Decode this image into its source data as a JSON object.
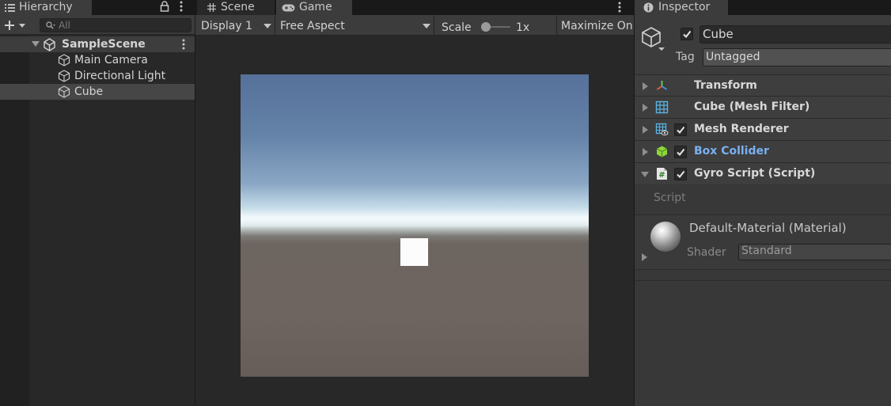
{
  "hierarchy": {
    "tab_label": "Hierarchy",
    "search_placeholder": "All",
    "scene_name": "SampleScene",
    "items": [
      {
        "label": "Main Camera",
        "selected": false
      },
      {
        "label": "Directional Light",
        "selected": false
      },
      {
        "label": "Cube",
        "selected": true
      }
    ]
  },
  "game": {
    "tabs": [
      {
        "label": "Scene",
        "icon": "grid-icon",
        "active": false
      },
      {
        "label": "Game",
        "icon": "gamepad-icon",
        "active": true
      }
    ],
    "display": "Display 1",
    "aspect": "Free Aspect",
    "scale_label": "Scale",
    "scale_value": "1x",
    "maximize_label": "Maximize On Play",
    "sky_color": "#56709a",
    "ground_color": "#6e6460",
    "cube_color": "#fcfcfc"
  },
  "inspector": {
    "tab_label": "Inspector",
    "object_name": "Cube",
    "object_active": true,
    "tag_label": "Tag",
    "tag_value": "Untagged",
    "components": [
      {
        "title": "Transform",
        "icon": "transform-axes-icon",
        "has_checkbox": false,
        "expanded": false
      },
      {
        "title": "Cube (Mesh Filter)",
        "icon": "mesh-filter-icon",
        "has_checkbox": false,
        "expanded": false
      },
      {
        "title": "Mesh Renderer",
        "icon": "mesh-renderer-icon",
        "has_checkbox": true,
        "enabled": true,
        "expanded": false
      },
      {
        "title": "Box Collider",
        "icon": "box-collider-icon",
        "has_checkbox": true,
        "enabled": true,
        "expanded": false,
        "title_color": "#7ab0f0"
      },
      {
        "title": "Gyro Script (Script)",
        "icon": "script-icon",
        "has_checkbox": true,
        "enabled": true,
        "expanded": true
      }
    ],
    "script_field_label": "Script",
    "material": {
      "name": "Default-Material (Material)",
      "shader_label": "Shader",
      "shader_value": "Standard"
    }
  }
}
